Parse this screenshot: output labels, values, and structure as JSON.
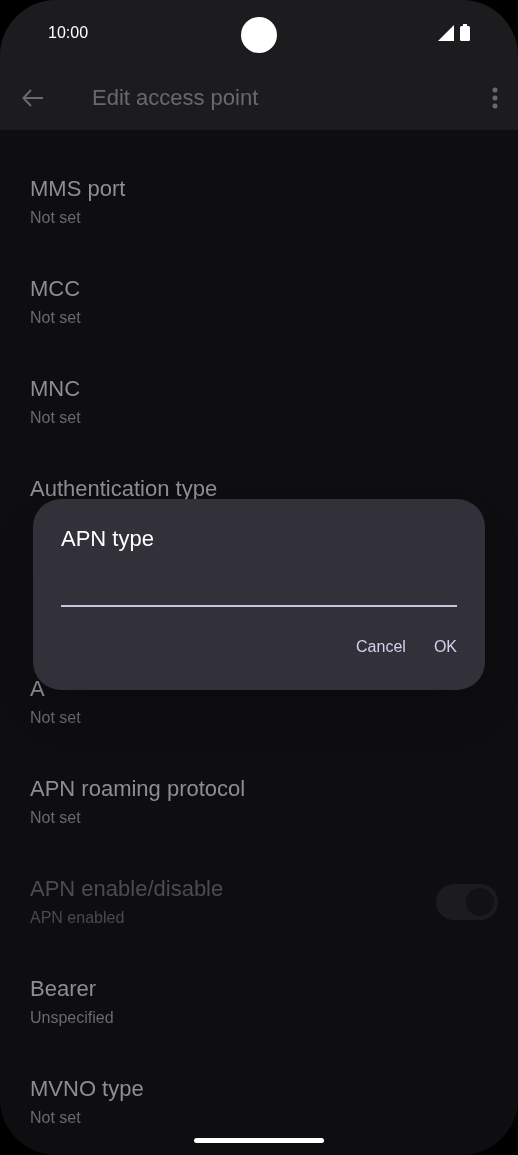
{
  "status_bar": {
    "time": "10:00"
  },
  "app_bar": {
    "title": "Edit access point"
  },
  "rows": [
    {
      "kind": "text",
      "title": "MMS port",
      "summary": "Not set",
      "disabled": false
    },
    {
      "kind": "text",
      "title": "MCC",
      "summary": "Not set",
      "disabled": false
    },
    {
      "kind": "text",
      "title": "MNC",
      "summary": "Not set",
      "disabled": false
    },
    {
      "kind": "text",
      "title": "Authentication type",
      "disabled": false
    },
    {
      "kind": "covered"
    },
    {
      "kind": "text",
      "title": "A",
      "summary": "Not set",
      "disabled": false
    },
    {
      "kind": "text",
      "title": "APN roaming protocol",
      "summary": "Not set",
      "disabled": false
    },
    {
      "kind": "switch",
      "title": "APN enable/disable",
      "summary": "APN enabled",
      "disabled": true,
      "on": true
    },
    {
      "kind": "text",
      "title": "Bearer",
      "summary": "Unspecified",
      "disabled": false
    },
    {
      "kind": "text",
      "title": "MVNO type",
      "summary": "Not set",
      "disabled": false
    }
  ],
  "dialog": {
    "title": "APN type",
    "buttons": [
      "Cancel",
      "OK"
    ]
  }
}
